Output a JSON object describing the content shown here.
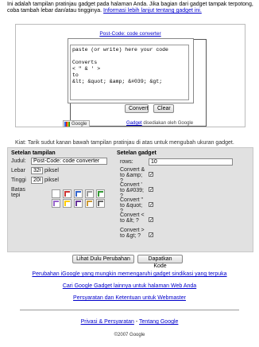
{
  "intro": {
    "text": "Ini adalah tampilan pratinjau gadget pada halaman Anda. Jika bagian dari gadget tampak terpotong, coba tambah lebar dan/atau tingginya.",
    "link": "Informasi lebih lanjut tentang gadget ini."
  },
  "gadget": {
    "title": "Post-Code: code converter",
    "code": "paste (or write) here your code\n\nConverts\n< \" & ' >\nto\n&lt; &quot; &amp; &#039; &gt;",
    "convert_label": "Convert",
    "clear_label": "Clear",
    "google_logo": "Google",
    "powered_link": "Gadget",
    "powered_text": "disediakan oleh Google"
  },
  "tip": "Kiat: Tarik sudut kanan bawah tampilan pratinjau di atas untuk mengubah ukuran gadget.",
  "settings": {
    "display": {
      "heading": "Setelan tampilan",
      "title_label": "Judul:",
      "title_value": "Post-Code: code converter",
      "width_label": "Lebar",
      "width_value": "320",
      "width_unit": "piksel",
      "height_label": "Tinggi",
      "height_value": "200",
      "height_unit": "piksel",
      "border_label": "Batas tepi"
    },
    "gadget": {
      "heading": "Setelan gadget",
      "rows_label": "rows:",
      "rows_value": "10",
      "options": [
        {
          "label": "Convert & to &amp; ?",
          "checked": true
        },
        {
          "label": "Convert ' to &#039; ?",
          "checked": true
        },
        {
          "label": "Convert \" to &quot; ?",
          "checked": true
        },
        {
          "label": "Convert < to &lt; ?",
          "checked": true
        },
        {
          "label": "Convert > to &gt; ?",
          "checked": true
        }
      ]
    },
    "border_swatch_colors": [
      "#ffffff",
      "#cc3333",
      "#3366cc",
      "#999999",
      "#339933",
      "#9966cc",
      "#ffcc00",
      "#663399",
      "#cc9933",
      "#666666"
    ]
  },
  "actions": {
    "preview_label": "Lihat Dulu Perubahan",
    "get_code_label": "Dapatkan Kode"
  },
  "links": {
    "change_igoogle": "Perubahan iGoogle yang mungkin memengaruhi gadget sindikasi yang terpuka",
    "find_gadgets": "Cari Google Gadget lainnya untuk halaman Web Anda",
    "terms": "Persyaratan dan Ketentuan untuk Webmaster"
  },
  "footer": {
    "privacy": "Privasi & Persyaratan",
    "separator": "-",
    "about": "Tentang Google",
    "copyright": "©2007 Google"
  }
}
